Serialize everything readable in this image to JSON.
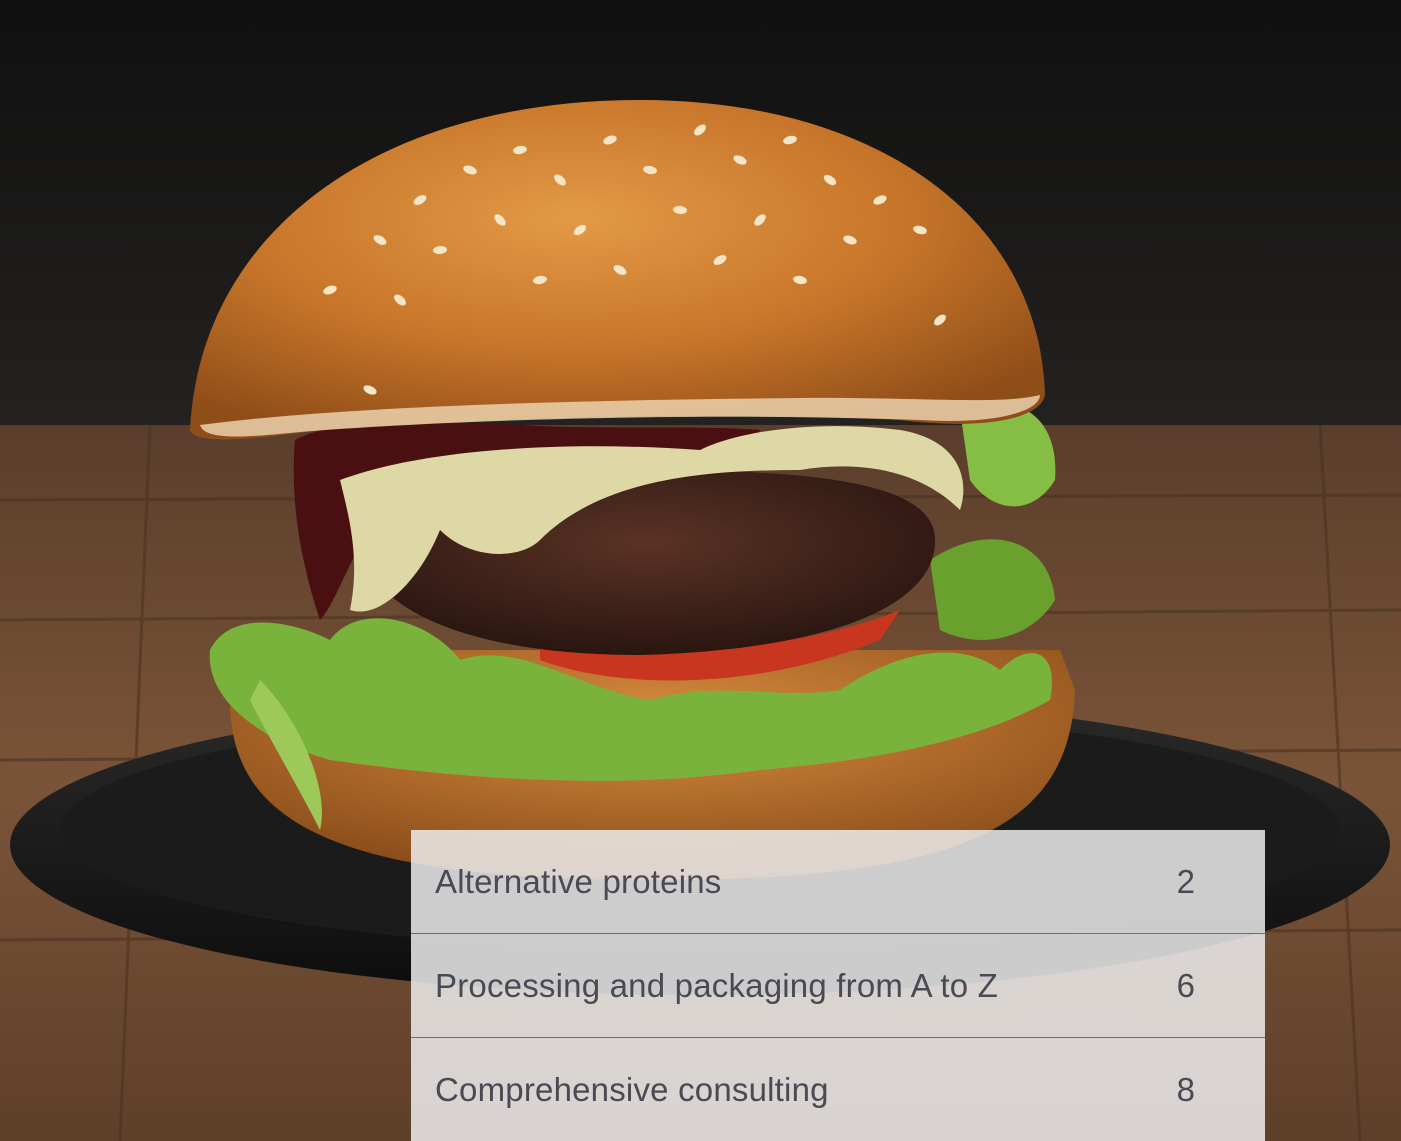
{
  "scene": {
    "subject": "burger-photo",
    "colors": {
      "wall": "#1c1a19",
      "table": "#6b4a33",
      "plate": "#141414",
      "bun": "#c9782a",
      "patty": "#3a2118",
      "lettuce": "#7ab33c",
      "tomato": "#c8361f",
      "cheese": "#ded7a6",
      "sauce": "#4a0f10"
    }
  },
  "toc": {
    "panel_color": "#ecebec",
    "text_color": "#4a4a55",
    "items": [
      {
        "label": "Alternative proteins",
        "page": "2"
      },
      {
        "label": "Processing and packaging from A to Z",
        "page": "6"
      },
      {
        "label": "Comprehensive consulting",
        "page": "8"
      }
    ]
  }
}
